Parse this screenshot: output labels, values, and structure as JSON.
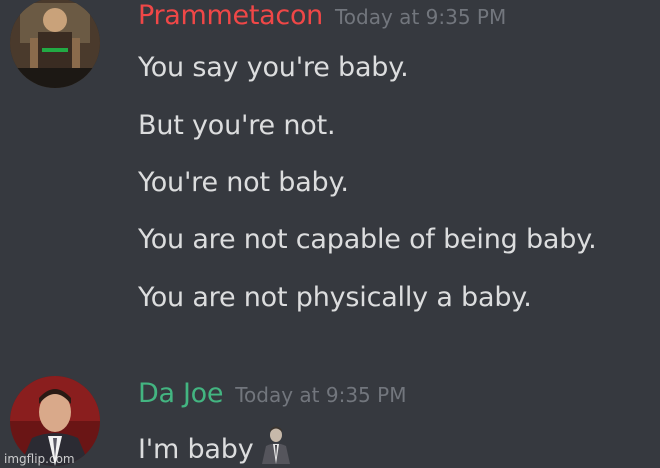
{
  "messages": [
    {
      "author": "Prammetacon",
      "author_color": "#f04747",
      "timestamp": "Today at 9:35 PM",
      "avatar_icon": "avatar-prammetacon",
      "lines": [
        "You say you're baby.",
        "But you're not.",
        "You're not baby.",
        "You are not capable of being baby.",
        "You are not physically a baby."
      ]
    },
    {
      "author": "Da Joe",
      "author_color": "#43b581",
      "timestamp": "Today at 9:35 PM",
      "avatar_icon": "avatar-da-joe",
      "lines": [
        "I'm baby"
      ],
      "emoji_icon": "man-in-suit-emoji"
    }
  ],
  "watermark": "imgflip.com",
  "colors": {
    "background": "#36393f",
    "message_text": "#dcddde",
    "timestamp": "#72767d"
  }
}
